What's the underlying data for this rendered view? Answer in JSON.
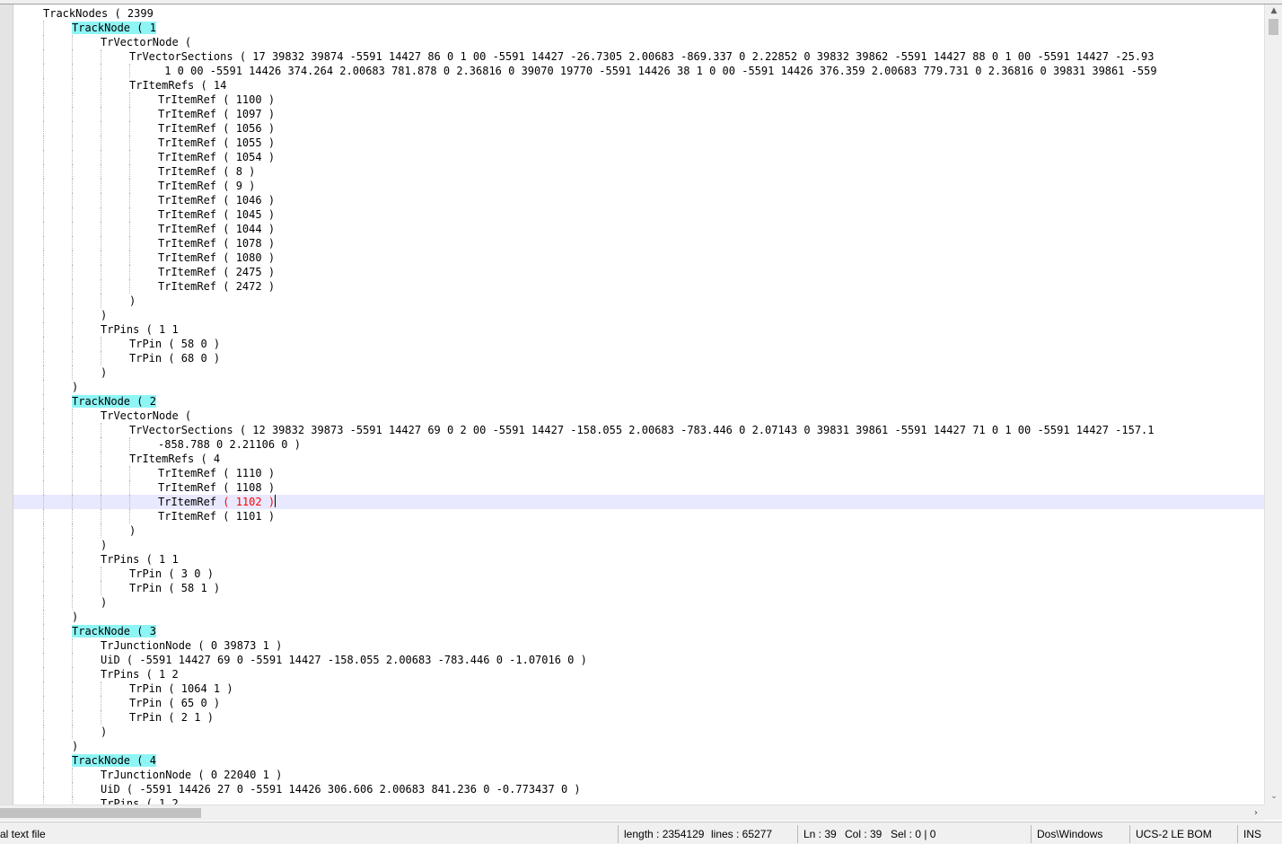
{
  "editor": {
    "indent_unit": "    ",
    "lines": [
      {
        "indent": 1,
        "text": "TrackNodes ( 2399"
      },
      {
        "indent": 2,
        "text": "TrackNode ( 1",
        "highlight": true
      },
      {
        "indent": 3,
        "text": "TrVectorNode ("
      },
      {
        "indent": 4,
        "text": "TrVectorSections ( 17 39832 39874 -5591 14427 86 0 1 00 -5591 14427 -26.7305 2.00683 -869.337 0 2.22852 0 39832 39862 -5591 14427 88 0 1 00 -5591 14427 -25.93"
      },
      {
        "indent": 5,
        "text": " 1 0 00 -5591 14426 374.264 2.00683 781.878 0 2.36816 0 39070 19770 -5591 14426 38 1 0 00 -5591 14426 376.359 2.00683 779.731 0 2.36816 0 39831 39861 -559"
      },
      {
        "indent": 4,
        "text": "TrItemRefs ( 14"
      },
      {
        "indent": 5,
        "text": "TrItemRef ( 1100 )"
      },
      {
        "indent": 5,
        "text": "TrItemRef ( 1097 )"
      },
      {
        "indent": 5,
        "text": "TrItemRef ( 1056 )"
      },
      {
        "indent": 5,
        "text": "TrItemRef ( 1055 )"
      },
      {
        "indent": 5,
        "text": "TrItemRef ( 1054 )"
      },
      {
        "indent": 5,
        "text": "TrItemRef ( 8 )"
      },
      {
        "indent": 5,
        "text": "TrItemRef ( 9 )"
      },
      {
        "indent": 5,
        "text": "TrItemRef ( 1046 )"
      },
      {
        "indent": 5,
        "text": "TrItemRef ( 1045 )"
      },
      {
        "indent": 5,
        "text": "TrItemRef ( 1044 )"
      },
      {
        "indent": 5,
        "text": "TrItemRef ( 1078 )"
      },
      {
        "indent": 5,
        "text": "TrItemRef ( 1080 )"
      },
      {
        "indent": 5,
        "text": "TrItemRef ( 2475 )"
      },
      {
        "indent": 5,
        "text": "TrItemRef ( 2472 )"
      },
      {
        "indent": 4,
        "text": ")"
      },
      {
        "indent": 3,
        "text": ")"
      },
      {
        "indent": 3,
        "text": "TrPins ( 1 1"
      },
      {
        "indent": 4,
        "text": "TrPin ( 58 0 )"
      },
      {
        "indent": 4,
        "text": "TrPin ( 68 0 )"
      },
      {
        "indent": 3,
        "text": ")"
      },
      {
        "indent": 2,
        "text": ")"
      },
      {
        "indent": 2,
        "text": "TrackNode ( 2",
        "highlight": true
      },
      {
        "indent": 3,
        "text": "TrVectorNode ("
      },
      {
        "indent": 4,
        "text": "TrVectorSections ( 12 39832 39873 -5591 14427 69 0 2 00 -5591 14427 -158.055 2.00683 -783.446 0 2.07143 0 39831 39861 -5591 14427 71 0 1 00 -5591 14427 -157.1"
      },
      {
        "indent": 5,
        "text": "-858.788 0 2.21106 0 )"
      },
      {
        "indent": 4,
        "text": "TrItemRefs ( 4"
      },
      {
        "indent": 5,
        "text": "TrItemRef ( 1110 )"
      },
      {
        "indent": 5,
        "text": "TrItemRef ( 1108 )"
      },
      {
        "indent": 5,
        "text": "TrItemRef ( 1102 )",
        "current": true
      },
      {
        "indent": 5,
        "text": "TrItemRef ( 1101 )"
      },
      {
        "indent": 4,
        "text": ")"
      },
      {
        "indent": 3,
        "text": ")"
      },
      {
        "indent": 3,
        "text": "TrPins ( 1 1"
      },
      {
        "indent": 4,
        "text": "TrPin ( 3 0 )"
      },
      {
        "indent": 4,
        "text": "TrPin ( 58 1 )"
      },
      {
        "indent": 3,
        "text": ")"
      },
      {
        "indent": 2,
        "text": ")"
      },
      {
        "indent": 2,
        "text": "TrackNode ( 3",
        "highlight": true
      },
      {
        "indent": 3,
        "text": "TrJunctionNode ( 0 39873 1 )"
      },
      {
        "indent": 3,
        "text": "UiD ( -5591 14427 69 0 -5591 14427 -158.055 2.00683 -783.446 0 -1.07016 0 )"
      },
      {
        "indent": 3,
        "text": "TrPins ( 1 2"
      },
      {
        "indent": 4,
        "text": "TrPin ( 1064 1 )"
      },
      {
        "indent": 4,
        "text": "TrPin ( 65 0 )"
      },
      {
        "indent": 4,
        "text": "TrPin ( 2 1 )"
      },
      {
        "indent": 3,
        "text": ")"
      },
      {
        "indent": 2,
        "text": ")"
      },
      {
        "indent": 2,
        "text": "TrackNode ( 4",
        "highlight": true
      },
      {
        "indent": 3,
        "text": "TrJunctionNode ( 0 22040 1 )"
      },
      {
        "indent": 3,
        "text": "UiD ( -5591 14426 27 0 -5591 14426 306.606 2.00683 841.236 0 -0.773437 0 )"
      },
      {
        "indent": 3,
        "text": "TrPins ( 1 2"
      }
    ]
  },
  "statusbar": {
    "file_type": "al text file",
    "length": "length : 2354129",
    "lines": "lines : 65277",
    "ln": "Ln : 39",
    "col": "Col : 39",
    "sel": "Sel : 0 | 0",
    "eol": "Dos\\Windows",
    "encoding": "UCS-2 LE BOM",
    "mode": "INS"
  },
  "scrollbars": {
    "up_arrow": "▲",
    "down_arrow": "⌄",
    "right_arrow": "›"
  }
}
